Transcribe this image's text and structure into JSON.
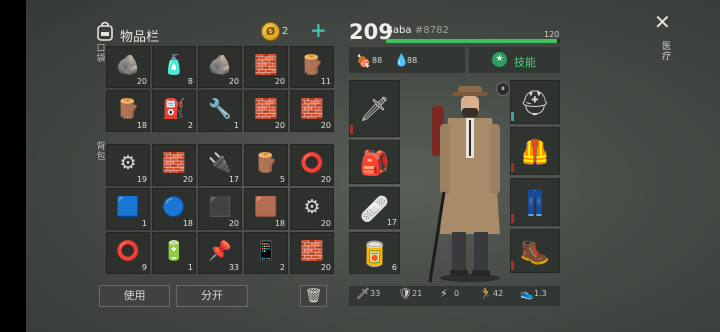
{
  "inventory": {
    "title": "物品栏",
    "coins": "2",
    "coins_add": "+",
    "pockets_label": "口袋",
    "backpack_label": "背包",
    "pocket_items": [
      {
        "name": "stone",
        "icon": "🪨",
        "qty": "20"
      },
      {
        "name": "water-bottle",
        "icon": "🧴",
        "qty": "8"
      },
      {
        "name": "stone",
        "icon": "🪨",
        "qty": "20"
      },
      {
        "name": "limestone",
        "icon": "🧱",
        "qty": "20"
      },
      {
        "name": "wood-plank",
        "icon": "🪵",
        "qty": "11"
      },
      {
        "name": "wood-plank",
        "icon": "🪵",
        "qty": "18"
      },
      {
        "name": "jerrycan",
        "icon": "⛽",
        "qty": "2"
      },
      {
        "name": "wrench",
        "icon": "🔧",
        "qty": "1"
      },
      {
        "name": "limestone",
        "icon": "🧱",
        "qty": "20"
      },
      {
        "name": "limestone",
        "icon": "🧱",
        "qty": "20"
      }
    ],
    "backpack_items": [
      {
        "name": "scrap-metal",
        "icon": "⚙",
        "qty": "19"
      },
      {
        "name": "limestone",
        "icon": "🧱",
        "qty": "20"
      },
      {
        "name": "transistors",
        "icon": "🔌",
        "qty": "17"
      },
      {
        "name": "log",
        "icon": "🪵",
        "qty": "5"
      },
      {
        "name": "tire",
        "icon": "⭕",
        "qty": "20"
      },
      {
        "name": "circuit-board",
        "icon": "🟦",
        "qty": "1"
      },
      {
        "name": "duct-tape",
        "icon": "🔵",
        "qty": "18"
      },
      {
        "name": "iron-bar",
        "icon": "⬛",
        "qty": "20"
      },
      {
        "name": "leather",
        "icon": "🟫",
        "qty": "18"
      },
      {
        "name": "scrap-metal",
        "icon": "⚙",
        "qty": "20"
      },
      {
        "name": "bearing",
        "icon": "⭕",
        "qty": "9"
      },
      {
        "name": "battery",
        "icon": "🔋",
        "qty": "1"
      },
      {
        "name": "nails",
        "icon": "📌",
        "qty": "33"
      },
      {
        "name": "smartphone",
        "icon": "📱",
        "qty": "2"
      },
      {
        "name": "limestone",
        "icon": "🧱",
        "qty": "20"
      }
    ],
    "buttons": {
      "use": "使用",
      "split": "分开",
      "trash": "🗑"
    }
  },
  "player": {
    "level": "209",
    "name": "Baba",
    "id": "#8782",
    "xp_value": "120",
    "xp_fraction": 0.98,
    "food": "88",
    "water": "88",
    "skills_label": "技能"
  },
  "equipment": {
    "weapon": {
      "icon": "🗡",
      "qty": ""
    },
    "backpack": {
      "icon": "🎒",
      "qty": ""
    },
    "medkit": {
      "icon": "🩹",
      "qty": "17"
    },
    "can": {
      "icon": "🥫",
      "qty": "6"
    },
    "helmet": {
      "icon": "⛑"
    },
    "vest": {
      "icon": "🦺"
    },
    "pants": {
      "icon": "👖"
    },
    "boots": {
      "icon": "🥾"
    }
  },
  "combat_stats": [
    {
      "icon": "🗡",
      "value": "33"
    },
    {
      "icon": "🛡",
      "value": "21"
    },
    {
      "icon": "⚡",
      "value": "0"
    },
    {
      "icon": "🏃",
      "value": "42"
    },
    {
      "icon": "👟",
      "value": "1.3"
    }
  ],
  "window": {
    "close": "✕",
    "side_tab": "医疗"
  },
  "colors": {
    "accent_green": "#42d27a",
    "xp_green": "#3fc060",
    "durability_red": "#b42a24"
  }
}
